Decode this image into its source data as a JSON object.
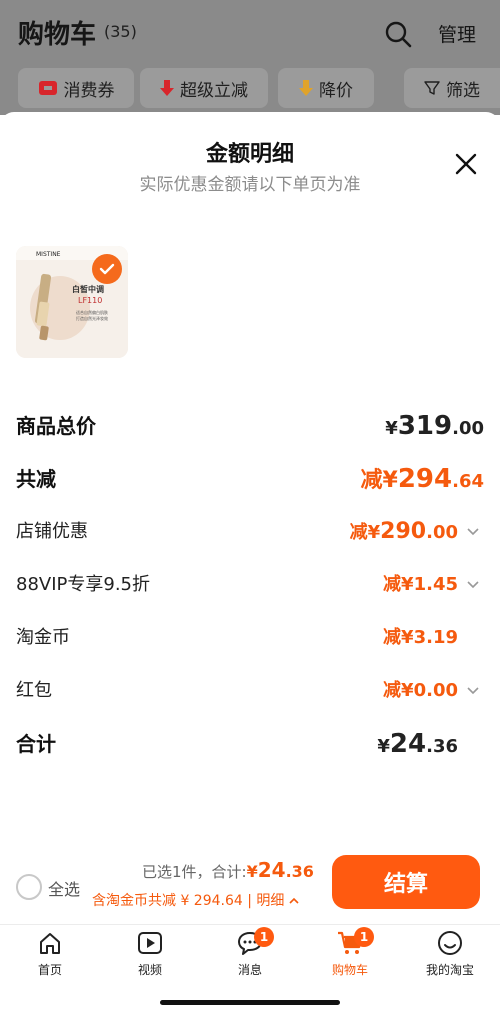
{
  "cart": {
    "title": "购物车",
    "count": "(35)",
    "manage_label": "管理",
    "filters": [
      {
        "label": "消费券",
        "icon": "coupon-icon"
      },
      {
        "label": "超级立减",
        "icon": "down-arrow-icon"
      },
      {
        "label": "降价",
        "icon": "price-drop-icon"
      },
      {
        "label": "筛选",
        "icon": "filter-icon"
      }
    ]
  },
  "sheet": {
    "title": "金额明细",
    "subtitle": "实际优惠金额请以下单页为准",
    "product": {
      "brand": "MISTINE",
      "shade_line1": "白皙中调",
      "shade_line2": "LF110",
      "small_text1": "适合自然偏白肌肤",
      "small_text2": "打造自然光泽妆效"
    },
    "rows": [
      {
        "label": "商品总价",
        "prefix": "",
        "currency": "¥",
        "int": "319",
        "dec": ".00",
        "style": "total"
      },
      {
        "label": "共减",
        "prefix": "减",
        "currency": "¥",
        "int": "294",
        "dec": ".64",
        "style": "discount-total"
      },
      {
        "label": "店铺优惠",
        "prefix": "减",
        "currency": "¥",
        "int": "290",
        "dec": ".00",
        "style": "discount",
        "expandable": true
      },
      {
        "label": "88VIP专享9.5折",
        "prefix": "减",
        "currency": "¥",
        "int": "1",
        "dec": ".45",
        "style": "discount",
        "expandable": true
      },
      {
        "label": "淘金币",
        "prefix": "减",
        "currency": "¥",
        "int": "3",
        "dec": ".19",
        "style": "discount"
      },
      {
        "label": "红包",
        "prefix": "减",
        "currency": "¥",
        "int": "0",
        "dec": ".00",
        "style": "discount",
        "expandable": true
      },
      {
        "label": "合计",
        "prefix": "",
        "currency": "¥",
        "int": "24",
        "dec": ".36",
        "style": "grand"
      }
    ]
  },
  "action_bar": {
    "select_all": "全选",
    "selected_text": "已选1件，合计:",
    "total_currency": "¥",
    "total_int": "24",
    "total_dec": ".36",
    "discount_text": "含淘金币共减 ¥ 294.64 | 明细",
    "checkout_label": "结算"
  },
  "tabs": [
    {
      "label": "首页",
      "icon": "home-icon",
      "badge": ""
    },
    {
      "label": "视频",
      "icon": "video-icon",
      "badge": ""
    },
    {
      "label": "消息",
      "icon": "message-icon",
      "badge": "1"
    },
    {
      "label": "购物车",
      "icon": "cart-icon",
      "badge": "1",
      "active": true
    },
    {
      "label": "我的淘宝",
      "icon": "profile-icon",
      "badge": ""
    }
  ],
  "colors": {
    "accent": "#ff5a10",
    "discount_text": "#f55a0e",
    "overlay": "#8a8a8a"
  }
}
